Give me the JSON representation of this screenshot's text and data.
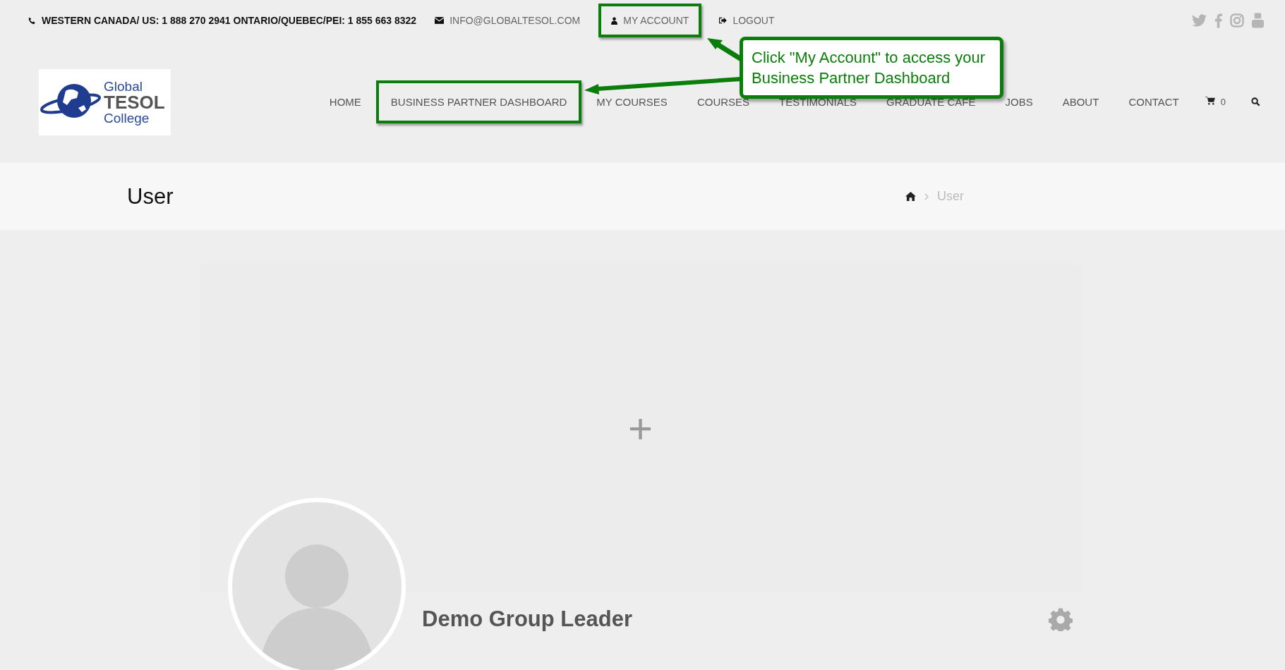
{
  "top_bar": {
    "phone": "WESTERN CANADA/ US: 1 888 270 2941 ONTARIO/QUEBEC/PEI: 1 855 663 8322",
    "email": "INFO@GLOBALTESOL.COM",
    "links": [
      {
        "kind": "account",
        "label": "MY ACCOUNT",
        "highlighted": true
      },
      {
        "kind": "logout",
        "label": "LOGOUT",
        "highlighted": false
      }
    ]
  },
  "logo": {
    "lines": [
      "Global",
      "TESOL",
      "College"
    ]
  },
  "nav": {
    "items": [
      {
        "label": "HOME",
        "highlighted": false
      },
      {
        "label": "BUSINESS PARTNER DASHBOARD",
        "highlighted": true
      },
      {
        "label": "MY COURSES",
        "highlighted": false
      },
      {
        "label": "COURSES",
        "highlighted": false
      },
      {
        "label": "TESTIMONIALS",
        "highlighted": false
      },
      {
        "label": "GRADUATE CAFE",
        "highlighted": false
      },
      {
        "label": "JOBS",
        "highlighted": false
      },
      {
        "label": "ABOUT",
        "highlighted": false
      },
      {
        "label": "CONTACT",
        "highlighted": false
      }
    ],
    "cart_count": "0"
  },
  "page_title": "User",
  "breadcrumb": {
    "current": "User"
  },
  "cover": {
    "add": "+"
  },
  "profile": {
    "name": "Demo Group Leader"
  },
  "callout": {
    "text": "Click \"My Account\" to access your Business Partner Dashboard"
  }
}
